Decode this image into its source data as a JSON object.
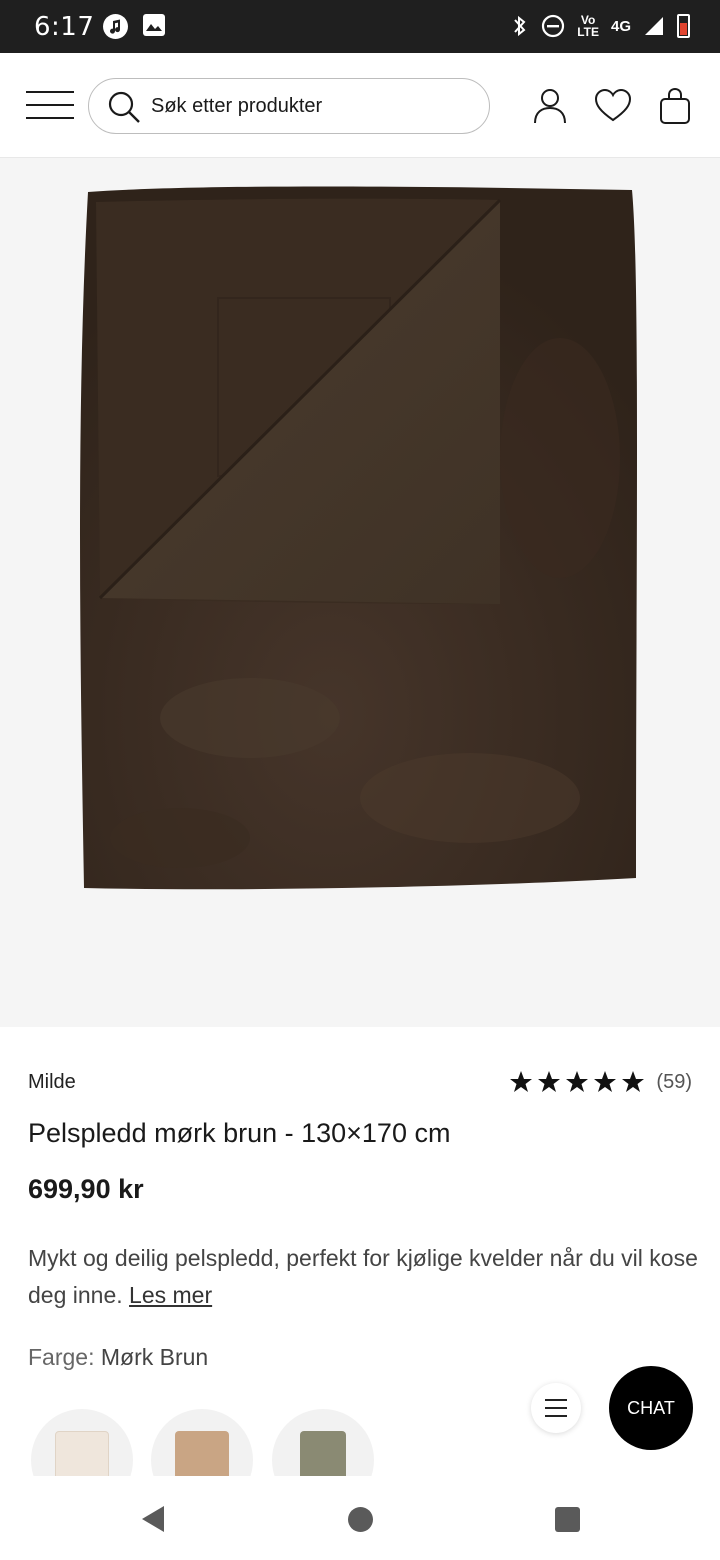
{
  "status_bar": {
    "time": "6:17",
    "icons": [
      "music-icon",
      "image-icon",
      "bluetooth-icon",
      "dnd-icon",
      "volte-icon",
      "signal-icon",
      "battery-icon"
    ],
    "volte_label": "Vo",
    "lte_label": "LTE",
    "network": "4G"
  },
  "header": {
    "search_placeholder": "Søk etter produkter",
    "icons": [
      "menu-icon",
      "search-icon",
      "account-icon",
      "heart-icon",
      "bag-icon"
    ]
  },
  "product": {
    "brand": "Milde",
    "rating_stars": 5,
    "rating_count": "(59)",
    "title": "Pelspledd mørk brun - 130×170 cm",
    "price": "699,90 kr",
    "description": "Mykt og deilig pelspledd, perfekt for kjølige kvelder når du vil kose deg inne.",
    "read_more": "Les mer",
    "color_label": "Farge:",
    "color_value": "Mørk Brun",
    "image_color": "#3d2d20",
    "swatches": [
      {
        "name": "cream",
        "color": "#efe6dc"
      },
      {
        "name": "beige",
        "color": "#c9a584"
      },
      {
        "name": "green",
        "color": "#8a8a73"
      }
    ]
  },
  "floating": {
    "chat_label": "CHAT"
  },
  "nav": {
    "buttons": [
      "back",
      "home",
      "recents"
    ]
  }
}
